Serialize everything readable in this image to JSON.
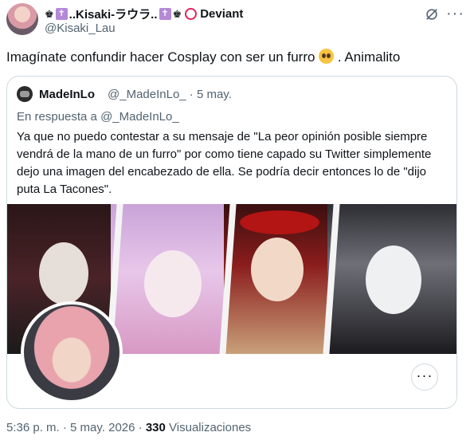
{
  "tweet": {
    "author": {
      "crown_glyph_1": "♚",
      "cross_glyph_1": "✝",
      "name_text": "..Kisaki-ラウラ..",
      "cross_glyph_2": "✝",
      "crown_glyph_2": "♚",
      "name_suffix": "Deviant",
      "handle": "@Kisaki_Lau"
    },
    "text_before_emoji": "Imagínate confundir  hacer Cosplay con ser un furro ",
    "emoji": "pleading-face",
    "text_after_emoji": " . Animalito",
    "timestamp": "5:36 p. m.",
    "separator": "·",
    "date": "5 may. 2026",
    "views_count": "330",
    "views_label": "Visualizaciones"
  },
  "quote": {
    "author_name": "MadeInLo",
    "author_handle": "@_MadeInLo_ · 5 may.",
    "reply_to": "En respuesta a @_MadeInLo_",
    "body": "Ya que no puedo contestar a su mensaje de \"La peor opinión posible siempre vendrá de la mano de un furro\" por como tiene capado su Twitter simplemente dejo una imagen del encabezado de ella. Se podría decir entonces lo de \"dijo puta La Tacones\".",
    "more_label": "···"
  },
  "icons": {
    "mute": "mute-icon",
    "more": "more-icon"
  },
  "labels": {
    "more_dots": "···"
  }
}
